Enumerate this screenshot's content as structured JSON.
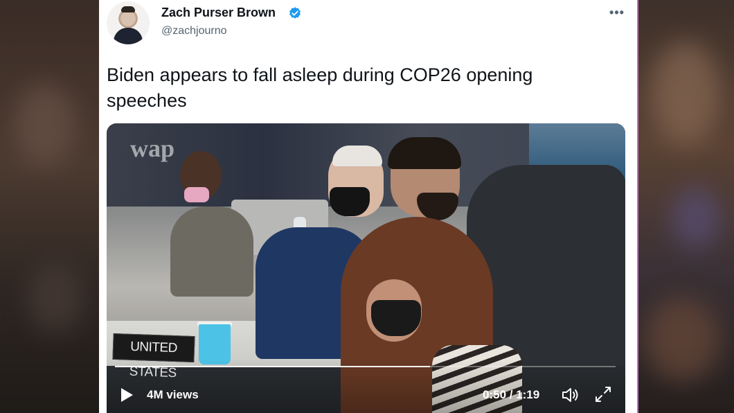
{
  "tweet": {
    "author_name": "Zach Purser Brown",
    "handle": "@zachjourno",
    "text": "Biden appears to fall asleep during COP26 opening speeches",
    "more_icon": "more-horizontal-icon",
    "verified_icon": "verified-badge-icon"
  },
  "video": {
    "overlay_logo": "wap",
    "country_sign": "UNITED STATES",
    "views": "4M views",
    "time": "0:50 / 1:19",
    "progress": 0.63,
    "play_icon": "play-icon",
    "volume_icon": "volume-icon",
    "fullscreen_icon": "fullscreen-icon"
  },
  "colors": {
    "verified_blue": "#1d9bf0",
    "text_primary": "#0f1419",
    "text_secondary": "#536471",
    "card_border_accent": "#c46cc0"
  }
}
